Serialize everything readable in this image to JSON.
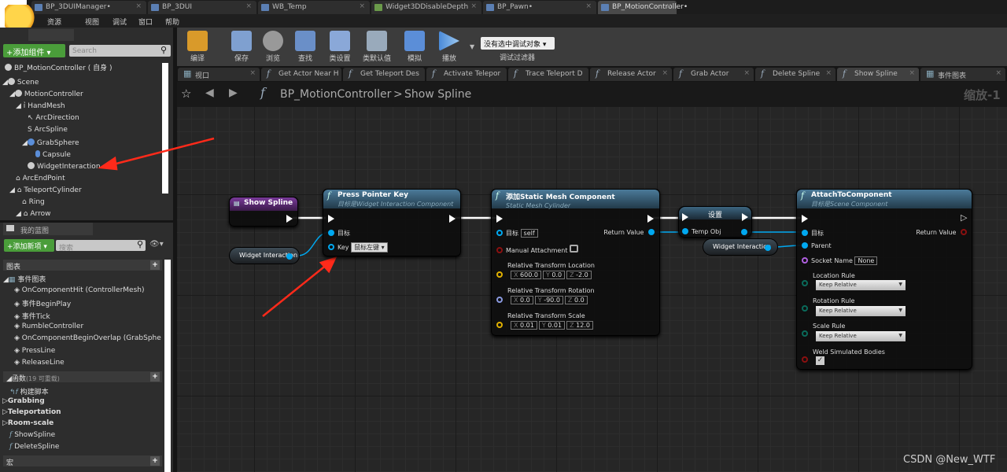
{
  "doc_tabs": [
    {
      "label": "BP_3DUIManager•"
    },
    {
      "label": "BP_3DUI"
    },
    {
      "label": "WB_Temp"
    },
    {
      "label": "Widget3DDisableDepth"
    },
    {
      "label": "BP_Pawn•"
    },
    {
      "label": "BP_MotionController•",
      "active": true
    }
  ],
  "menu": [
    "资源",
    "视图",
    "调试",
    "窗口",
    "帮助"
  ],
  "components": {
    "add_label": "+添加组件 ▾",
    "search_placeholder": "Search",
    "self": "BP_MotionController ( 自身 )",
    "tree": [
      "Scene",
      "MotionController",
      "HandMesh",
      "ArcDirection",
      "ArcSpline",
      "GrabSphere",
      "Capsule",
      "WidgetInteraction",
      "ArcEndPoint",
      "TeleportCylinder",
      "Ring",
      "Arrow"
    ]
  },
  "my_blueprint": {
    "tab": "我的蓝图",
    "add_label": "+添加新项 ▾",
    "search_placeholder": "搜索",
    "graphs_header": "图表",
    "event_graph": "事件图表",
    "events": [
      "OnComponentHit (ControllerMesh)",
      "事件BeginPlay",
      "事件Tick",
      "RumbleController",
      "OnComponentBeginOverlap (GrabSphe",
      "PressLine",
      "ReleaseLine"
    ],
    "functions_header": "函数",
    "functions_count": "(19 可重载)",
    "functions": [
      "构建脚本",
      "Grabbing",
      "Teleportation",
      "Room-scale",
      "ShowSpline",
      "DeleteSpline"
    ],
    "macros_header": "宏"
  },
  "toolbar": {
    "buttons": [
      "编译",
      "保存",
      "浏览",
      "查找",
      "类设置",
      "类默认值",
      "模拟",
      "播放"
    ],
    "debug_select": "没有选中调试对象 ▾",
    "debug_filter": "调试过滤器"
  },
  "graph_tabs": [
    "视口",
    "Get Actor Near H",
    "Get Teleport Des",
    "Activate Telepor",
    "Trace Teleport D",
    "Release Actor",
    "Grab Actor",
    "Delete Spline",
    "Show Spline",
    "事件图表"
  ],
  "breadcrumb": {
    "blueprint": "BP_MotionController",
    "separator": ">",
    "function": "Show Spline"
  },
  "zoom_label": "缩放-1",
  "nodes": {
    "entry": {
      "title": "Show Spline"
    },
    "press": {
      "title": "Press Pointer Key",
      "subtitle": "目标是Widget Interaction Component",
      "target": "目标",
      "key": "Key",
      "key_value": "鼠标左键 ▾"
    },
    "var1": {
      "label": "Widget Interaction"
    },
    "addmesh": {
      "title": "添加Static Mesh Component",
      "subtitle": "Static Mesh Cylinder",
      "target": "目标",
      "target_value": "self",
      "manual": "Manual Attachment",
      "ret": "Return Value",
      "loc": "Relative Transform Location",
      "loc_v": [
        "X",
        "600.0",
        "Y",
        "0.0",
        "Z",
        "-2.0"
      ],
      "rot": "Relative Transform Rotation",
      "rot_v": [
        "X",
        "0.0",
        "Y",
        "-90.0",
        "Z",
        "0.0"
      ],
      "scale": "Relative Transform Scale",
      "scale_v": [
        "X",
        "0.01",
        "Y",
        "0.01",
        "Z",
        "12.0"
      ]
    },
    "set": {
      "title": "设置",
      "pin": "Temp Obj"
    },
    "var2": {
      "label": "Widget Interaction"
    },
    "attach": {
      "title": "AttachToComponent",
      "subtitle": "目标是Scene Component",
      "target": "目标",
      "ret": "Return Value",
      "parent": "Parent",
      "socket": "Socket Name",
      "socket_value": "None",
      "loc_rule": "Location Rule",
      "rot_rule": "Rotation Rule",
      "scale_rule": "Scale Rule",
      "rule_value": "Keep Relative",
      "weld": "Weld Simulated Bodies",
      "weld_checked": true
    }
  },
  "watermark": "CSDN @New_WTF",
  "colors": {
    "annotation_arrow": "#ff2a1a",
    "object_pin": "#00a8f0",
    "exec_wire": "#ffffff",
    "accent_green": "#4a9d3a"
  }
}
